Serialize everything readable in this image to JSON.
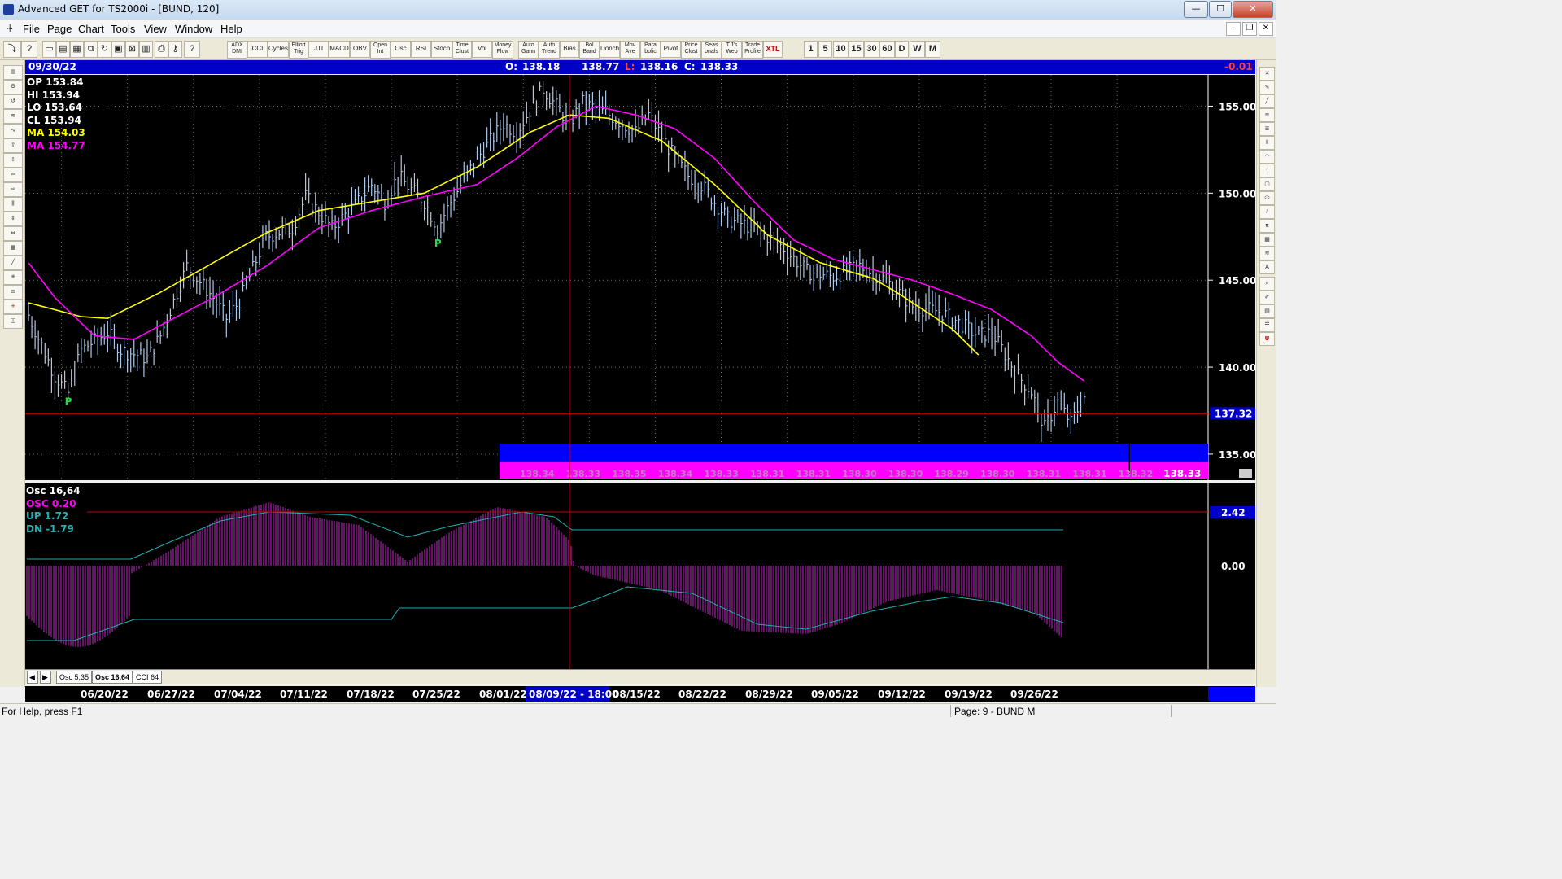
{
  "window": {
    "title": "Advanced GET for TS2000i - [BUND, 120]",
    "controls": {
      "minimize": "—",
      "maximize": "☐",
      "close": "✕"
    }
  },
  "menu": [
    "File",
    "Page",
    "Chart",
    "Tools",
    "View",
    "Window",
    "Help"
  ],
  "toolbar": {
    "studies": [
      "ADX DMI",
      "CCI",
      "Cycles",
      "Elliott Trig",
      "JTI",
      "MACD",
      "OBV",
      "Open Int",
      "Osc",
      "RSI",
      "Stoch",
      "Time Clust",
      "Vol",
      "Money Flow",
      "Auto Gann",
      "Auto Trend",
      "Bias",
      "Bol Band",
      "Donch",
      "Mov Ave",
      "Para bolic",
      "Pivot",
      "Price Clust",
      "Seas onals",
      "T.J's Web",
      "Trade Profile",
      "XTL"
    ],
    "periods": [
      "1",
      "5",
      "10",
      "15",
      "30",
      "60",
      "D",
      "W",
      "M"
    ]
  },
  "header": {
    "date": "09/30/22",
    "open_label": "O:",
    "open": "138.18",
    "high": "138.77",
    "low_label": "L:",
    "low": "138.16",
    "close_label": "C:",
    "close": "138.33",
    "change": "-0.01"
  },
  "readout": {
    "op": {
      "label": "OP",
      "value": "153.84"
    },
    "hi": {
      "label": "HI",
      "value": "153.94"
    },
    "lo": {
      "label": "LO",
      "value": "153.64"
    },
    "cl": {
      "label": "CL",
      "value": "153.94"
    },
    "ma1": {
      "label": "MA",
      "value": "154.03"
    },
    "ma2": {
      "label": "MA",
      "value": "154.77"
    }
  },
  "price_axis": {
    "ticks": [
      "155.00",
      "150.00",
      "145.00",
      "140.00",
      "135.00"
    ],
    "current_price_label": "137.32",
    "tick_values": [
      155,
      150,
      145,
      140,
      135
    ],
    "current_price": 137.32
  },
  "pivots": [
    {
      "label": "P",
      "day": 3,
      "price": 138.2
    },
    {
      "label": "P",
      "day": 31,
      "price": 147.3
    }
  ],
  "bottom_band": {
    "labels": [
      "138.34",
      "138.33",
      "138.35",
      "138.34",
      "138.33",
      "138.31",
      "138.31",
      "138.30",
      "138.30",
      "138.29",
      "138.30",
      "138.31",
      "138.31",
      "138.32"
    ],
    "last_label": "138.33"
  },
  "oscillator": {
    "title": "Osc 16,64",
    "osc": {
      "label": "OSC",
      "value": "0.20"
    },
    "up": {
      "label": "UP",
      "value": "1.72"
    },
    "dn": {
      "label": "DN",
      "value": "-1.79"
    },
    "ref_label": "2.42",
    "zero_label": "0.00"
  },
  "tabs": [
    "Osc 5,35",
    "Osc 16,64",
    "CCI 64"
  ],
  "date_axis": {
    "labels": [
      "06/20/22",
      "06/27/22",
      "07/04/22",
      "07/11/22",
      "07/18/22",
      "07/25/22",
      "08/01/22",
      "08/15/22",
      "08/22/22",
      "08/29/22",
      "09/05/22",
      "09/12/22",
      "09/19/22",
      "09/26/22"
    ],
    "cursor_label": "08/09/22 - 18:00"
  },
  "status": {
    "help": "For Help, press F1",
    "page": "Page: 9 - BUND M"
  },
  "chart_data": {
    "type": "line",
    "x_unit": "trading days from 06/16/22",
    "y_range": [
      133.5,
      156.8
    ],
    "series": [
      {
        "name": "BUND",
        "x": [
          0,
          2,
          3,
          4,
          6,
          7,
          9,
          10,
          12,
          14,
          15,
          16,
          18,
          20,
          21,
          23,
          25,
          26,
          27,
          28,
          29,
          30,
          31,
          32,
          34,
          35,
          36,
          37,
          39,
          40,
          41,
          42,
          44,
          45,
          46,
          47,
          49,
          50,
          51,
          53,
          55,
          57,
          59,
          61,
          63,
          65,
          67,
          69,
          70,
          72,
          73,
          75,
          76,
          77,
          78,
          79,
          80
        ],
        "y": [
          143.0,
          139.5,
          138.5,
          141.0,
          142.0,
          141.0,
          140.5,
          141.8,
          145.8,
          144.0,
          142.8,
          143.8,
          147.5,
          148.0,
          149.8,
          148.0,
          149.5,
          150.5,
          149.5,
          151.0,
          150.2,
          149.5,
          148.0,
          149.5,
          152.0,
          153.0,
          154.0,
          153.5,
          156.0,
          155.0,
          154.0,
          155.2,
          154.5,
          154.0,
          153.5,
          154.5,
          152.0,
          151.0,
          150.5,
          148.5,
          148.0,
          147.0,
          145.5,
          145.2,
          145.8,
          145.0,
          143.5,
          143.2,
          142.8,
          141.8,
          142.0,
          139.5,
          138.6,
          136.5,
          138.0,
          136.8,
          138.3
        ]
      },
      {
        "name": "MA",
        "x": [
          0,
          4,
          6,
          10,
          14,
          18,
          22,
          26,
          30,
          34,
          38,
          41,
          44,
          48,
          52,
          56,
          60,
          64,
          66,
          68,
          70,
          72
        ],
        "y": [
          143.7,
          142.9,
          142.8,
          144.3,
          146.0,
          147.7,
          149.0,
          149.5,
          150.0,
          151.5,
          153.5,
          154.5,
          154.3,
          153.0,
          150.5,
          147.6,
          146.0,
          145.1,
          144.2,
          143.2,
          142.2,
          140.7
        ]
      },
      {
        "name": "MA",
        "x": [
          0,
          2,
          5,
          8,
          11,
          14,
          18,
          22,
          26,
          30,
          34,
          37,
          40,
          43,
          46,
          49,
          52,
          55,
          58,
          61,
          64,
          67,
          70,
          73,
          76,
          78,
          80
        ],
        "y": [
          146.0,
          144.0,
          141.8,
          141.6,
          142.8,
          144.0,
          145.8,
          148.0,
          149.0,
          149.8,
          150.5,
          152.0,
          153.8,
          155.0,
          154.5,
          153.7,
          152.0,
          149.5,
          147.3,
          146.2,
          145.6,
          145.0,
          144.2,
          143.3,
          141.8,
          140.3,
          139.2
        ]
      }
    ]
  }
}
